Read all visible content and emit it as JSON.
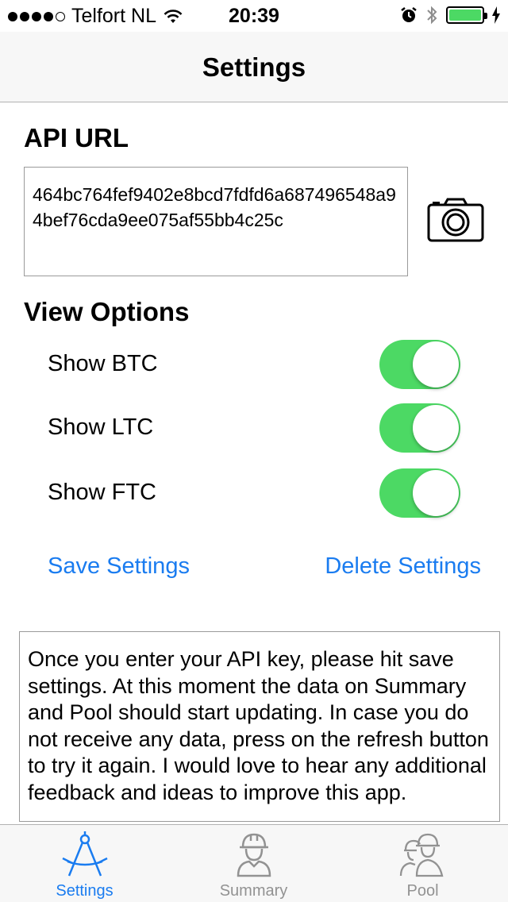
{
  "status_bar": {
    "carrier": "Telfort NL",
    "time": "20:39"
  },
  "nav": {
    "title": "Settings"
  },
  "api": {
    "title": "API URL",
    "value": "464bc764fef9402e8bcd7fdfd6a687496548a94bef76cda9ee075af55bb4c25c"
  },
  "view_options": {
    "title": "View Options",
    "items": [
      {
        "label": "Show BTC",
        "on": true
      },
      {
        "label": "Show LTC",
        "on": true
      },
      {
        "label": "Show FTC",
        "on": true
      }
    ]
  },
  "actions": {
    "save_label": "Save Settings",
    "delete_label": "Delete Settings"
  },
  "info_text": "Once you enter your API key, please hit save settings. At this moment the data on Summary and Pool should start updating. In case you do not receive any data, press on the refresh button to try it again. I would love to hear any additional feedback and ideas to improve this app.",
  "tabs": [
    {
      "label": "Settings",
      "icon": "compass-icon",
      "active": true
    },
    {
      "label": "Summary",
      "icon": "miner-icon",
      "active": false
    },
    {
      "label": "Pool",
      "icon": "miners-group-icon",
      "active": false
    }
  ],
  "colors": {
    "accent": "#1a7cf0",
    "toggle_on": "#4cd964",
    "inactive_tab": "#929292"
  }
}
